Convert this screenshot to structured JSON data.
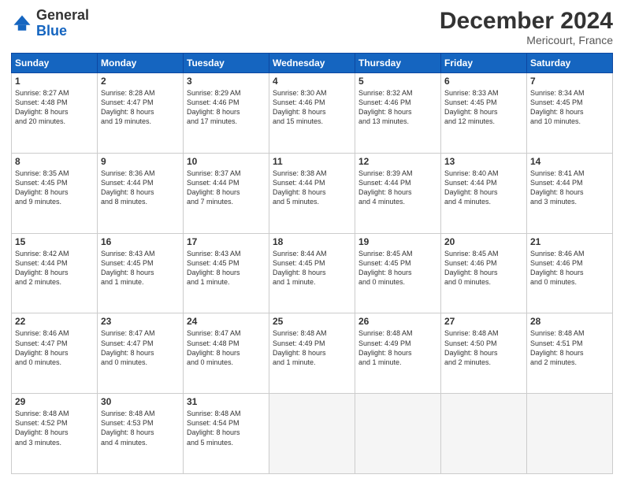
{
  "header": {
    "logo_general": "General",
    "logo_blue": "Blue",
    "month_title": "December 2024",
    "subtitle": "Mericourt, France"
  },
  "days_of_week": [
    "Sunday",
    "Monday",
    "Tuesday",
    "Wednesday",
    "Thursday",
    "Friday",
    "Saturday"
  ],
  "weeks": [
    [
      {
        "day": 1,
        "lines": [
          "Sunrise: 8:27 AM",
          "Sunset: 4:48 PM",
          "Daylight: 8 hours",
          "and 20 minutes."
        ]
      },
      {
        "day": 2,
        "lines": [
          "Sunrise: 8:28 AM",
          "Sunset: 4:47 PM",
          "Daylight: 8 hours",
          "and 19 minutes."
        ]
      },
      {
        "day": 3,
        "lines": [
          "Sunrise: 8:29 AM",
          "Sunset: 4:46 PM",
          "Daylight: 8 hours",
          "and 17 minutes."
        ]
      },
      {
        "day": 4,
        "lines": [
          "Sunrise: 8:30 AM",
          "Sunset: 4:46 PM",
          "Daylight: 8 hours",
          "and 15 minutes."
        ]
      },
      {
        "day": 5,
        "lines": [
          "Sunrise: 8:32 AM",
          "Sunset: 4:46 PM",
          "Daylight: 8 hours",
          "and 13 minutes."
        ]
      },
      {
        "day": 6,
        "lines": [
          "Sunrise: 8:33 AM",
          "Sunset: 4:45 PM",
          "Daylight: 8 hours",
          "and 12 minutes."
        ]
      },
      {
        "day": 7,
        "lines": [
          "Sunrise: 8:34 AM",
          "Sunset: 4:45 PM",
          "Daylight: 8 hours",
          "and 10 minutes."
        ]
      }
    ],
    [
      {
        "day": 8,
        "lines": [
          "Sunrise: 8:35 AM",
          "Sunset: 4:45 PM",
          "Daylight: 8 hours",
          "and 9 minutes."
        ]
      },
      {
        "day": 9,
        "lines": [
          "Sunrise: 8:36 AM",
          "Sunset: 4:44 PM",
          "Daylight: 8 hours",
          "and 8 minutes."
        ]
      },
      {
        "day": 10,
        "lines": [
          "Sunrise: 8:37 AM",
          "Sunset: 4:44 PM",
          "Daylight: 8 hours",
          "and 7 minutes."
        ]
      },
      {
        "day": 11,
        "lines": [
          "Sunrise: 8:38 AM",
          "Sunset: 4:44 PM",
          "Daylight: 8 hours",
          "and 5 minutes."
        ]
      },
      {
        "day": 12,
        "lines": [
          "Sunrise: 8:39 AM",
          "Sunset: 4:44 PM",
          "Daylight: 8 hours",
          "and 4 minutes."
        ]
      },
      {
        "day": 13,
        "lines": [
          "Sunrise: 8:40 AM",
          "Sunset: 4:44 PM",
          "Daylight: 8 hours",
          "and 4 minutes."
        ]
      },
      {
        "day": 14,
        "lines": [
          "Sunrise: 8:41 AM",
          "Sunset: 4:44 PM",
          "Daylight: 8 hours",
          "and 3 minutes."
        ]
      }
    ],
    [
      {
        "day": 15,
        "lines": [
          "Sunrise: 8:42 AM",
          "Sunset: 4:44 PM",
          "Daylight: 8 hours",
          "and 2 minutes."
        ]
      },
      {
        "day": 16,
        "lines": [
          "Sunrise: 8:43 AM",
          "Sunset: 4:45 PM",
          "Daylight: 8 hours",
          "and 1 minute."
        ]
      },
      {
        "day": 17,
        "lines": [
          "Sunrise: 8:43 AM",
          "Sunset: 4:45 PM",
          "Daylight: 8 hours",
          "and 1 minute."
        ]
      },
      {
        "day": 18,
        "lines": [
          "Sunrise: 8:44 AM",
          "Sunset: 4:45 PM",
          "Daylight: 8 hours",
          "and 1 minute."
        ]
      },
      {
        "day": 19,
        "lines": [
          "Sunrise: 8:45 AM",
          "Sunset: 4:45 PM",
          "Daylight: 8 hours",
          "and 0 minutes."
        ]
      },
      {
        "day": 20,
        "lines": [
          "Sunrise: 8:45 AM",
          "Sunset: 4:46 PM",
          "Daylight: 8 hours",
          "and 0 minutes."
        ]
      },
      {
        "day": 21,
        "lines": [
          "Sunrise: 8:46 AM",
          "Sunset: 4:46 PM",
          "Daylight: 8 hours",
          "and 0 minutes."
        ]
      }
    ],
    [
      {
        "day": 22,
        "lines": [
          "Sunrise: 8:46 AM",
          "Sunset: 4:47 PM",
          "Daylight: 8 hours",
          "and 0 minutes."
        ]
      },
      {
        "day": 23,
        "lines": [
          "Sunrise: 8:47 AM",
          "Sunset: 4:47 PM",
          "Daylight: 8 hours",
          "and 0 minutes."
        ]
      },
      {
        "day": 24,
        "lines": [
          "Sunrise: 8:47 AM",
          "Sunset: 4:48 PM",
          "Daylight: 8 hours",
          "and 0 minutes."
        ]
      },
      {
        "day": 25,
        "lines": [
          "Sunrise: 8:48 AM",
          "Sunset: 4:49 PM",
          "Daylight: 8 hours",
          "and 1 minute."
        ]
      },
      {
        "day": 26,
        "lines": [
          "Sunrise: 8:48 AM",
          "Sunset: 4:49 PM",
          "Daylight: 8 hours",
          "and 1 minute."
        ]
      },
      {
        "day": 27,
        "lines": [
          "Sunrise: 8:48 AM",
          "Sunset: 4:50 PM",
          "Daylight: 8 hours",
          "and 2 minutes."
        ]
      },
      {
        "day": 28,
        "lines": [
          "Sunrise: 8:48 AM",
          "Sunset: 4:51 PM",
          "Daylight: 8 hours",
          "and 2 minutes."
        ]
      }
    ],
    [
      {
        "day": 29,
        "lines": [
          "Sunrise: 8:48 AM",
          "Sunset: 4:52 PM",
          "Daylight: 8 hours",
          "and 3 minutes."
        ]
      },
      {
        "day": 30,
        "lines": [
          "Sunrise: 8:48 AM",
          "Sunset: 4:53 PM",
          "Daylight: 8 hours",
          "and 4 minutes."
        ]
      },
      {
        "day": 31,
        "lines": [
          "Sunrise: 8:48 AM",
          "Sunset: 4:54 PM",
          "Daylight: 8 hours",
          "and 5 minutes."
        ]
      },
      null,
      null,
      null,
      null
    ]
  ]
}
